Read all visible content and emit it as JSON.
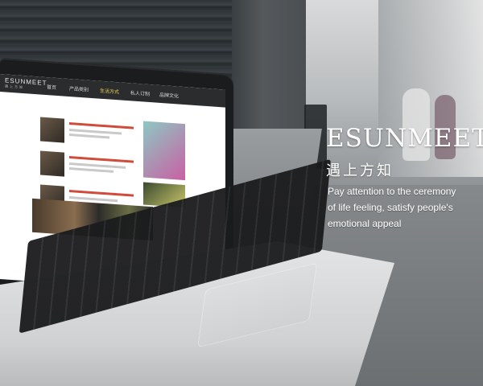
{
  "overlay": {
    "brand_title": "ESUNMEET",
    "brand_subtitle": "遇上方知",
    "tagline_lines": [
      "Pay attention to the ceremony",
      "of life feeling, satisfy people's",
      "emotional appeal"
    ]
  },
  "laptop_screen": {
    "site_logo": "ESUNMEET",
    "site_logo_sub": "遇上方知",
    "nav_items": [
      "首页",
      "产品类别",
      "生活方式",
      "私人订制",
      "品牌文化"
    ]
  },
  "colors": {
    "overlay_text": "#ffffff",
    "screen_nav_bg": "#2b2c2e",
    "screen_bg": "#ffffff",
    "accent_nav_active": "#f0d35a"
  }
}
